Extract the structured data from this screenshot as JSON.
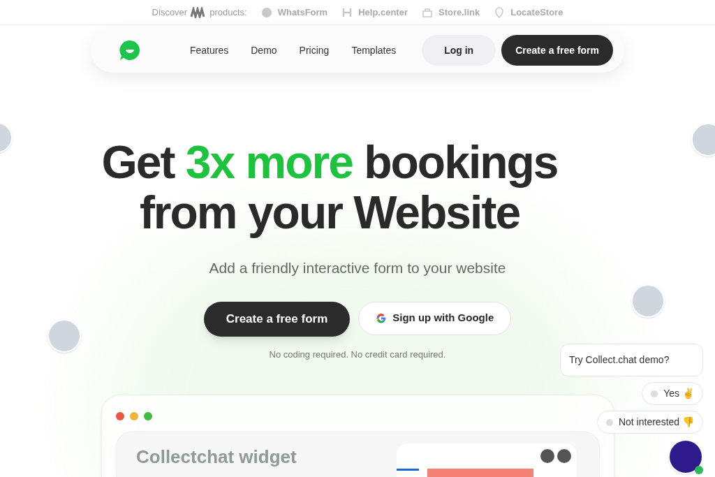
{
  "top_bar": {
    "discover": "Discover",
    "products_label": "products:",
    "products": [
      {
        "name": "WhatsForm",
        "kind": "chat"
      },
      {
        "name": "Help.center",
        "kind": "help"
      },
      {
        "name": "Store.link",
        "kind": "bag"
      },
      {
        "name": "LocateStore",
        "kind": "pin"
      }
    ]
  },
  "nav": {
    "links": [
      "Features",
      "Demo",
      "Pricing",
      "Templates"
    ],
    "login": "Log in",
    "cta": "Create a free form"
  },
  "hero": {
    "headline_lines": [
      [
        {
          "text": "Get ",
          "highlight": false
        },
        {
          "text": "3x more",
          "highlight": true
        },
        {
          "text": " bookings",
          "highlight": false
        }
      ],
      [
        {
          "text": "from your Website",
          "highlight": false
        }
      ]
    ],
    "subtitle": "Add a friendly interactive form to your website",
    "primary_button": "Create a free form",
    "google_button": "Sign up with Google",
    "note": "No coding required. No credit card required."
  },
  "preview": {
    "title": "Collectchat widget"
  },
  "chat": {
    "question": "Try Collect.chat demo?",
    "options": [
      {
        "label": "Yes",
        "emoji": "✌️"
      },
      {
        "label": "Not interested",
        "emoji": "👎"
      }
    ],
    "online": true
  }
}
